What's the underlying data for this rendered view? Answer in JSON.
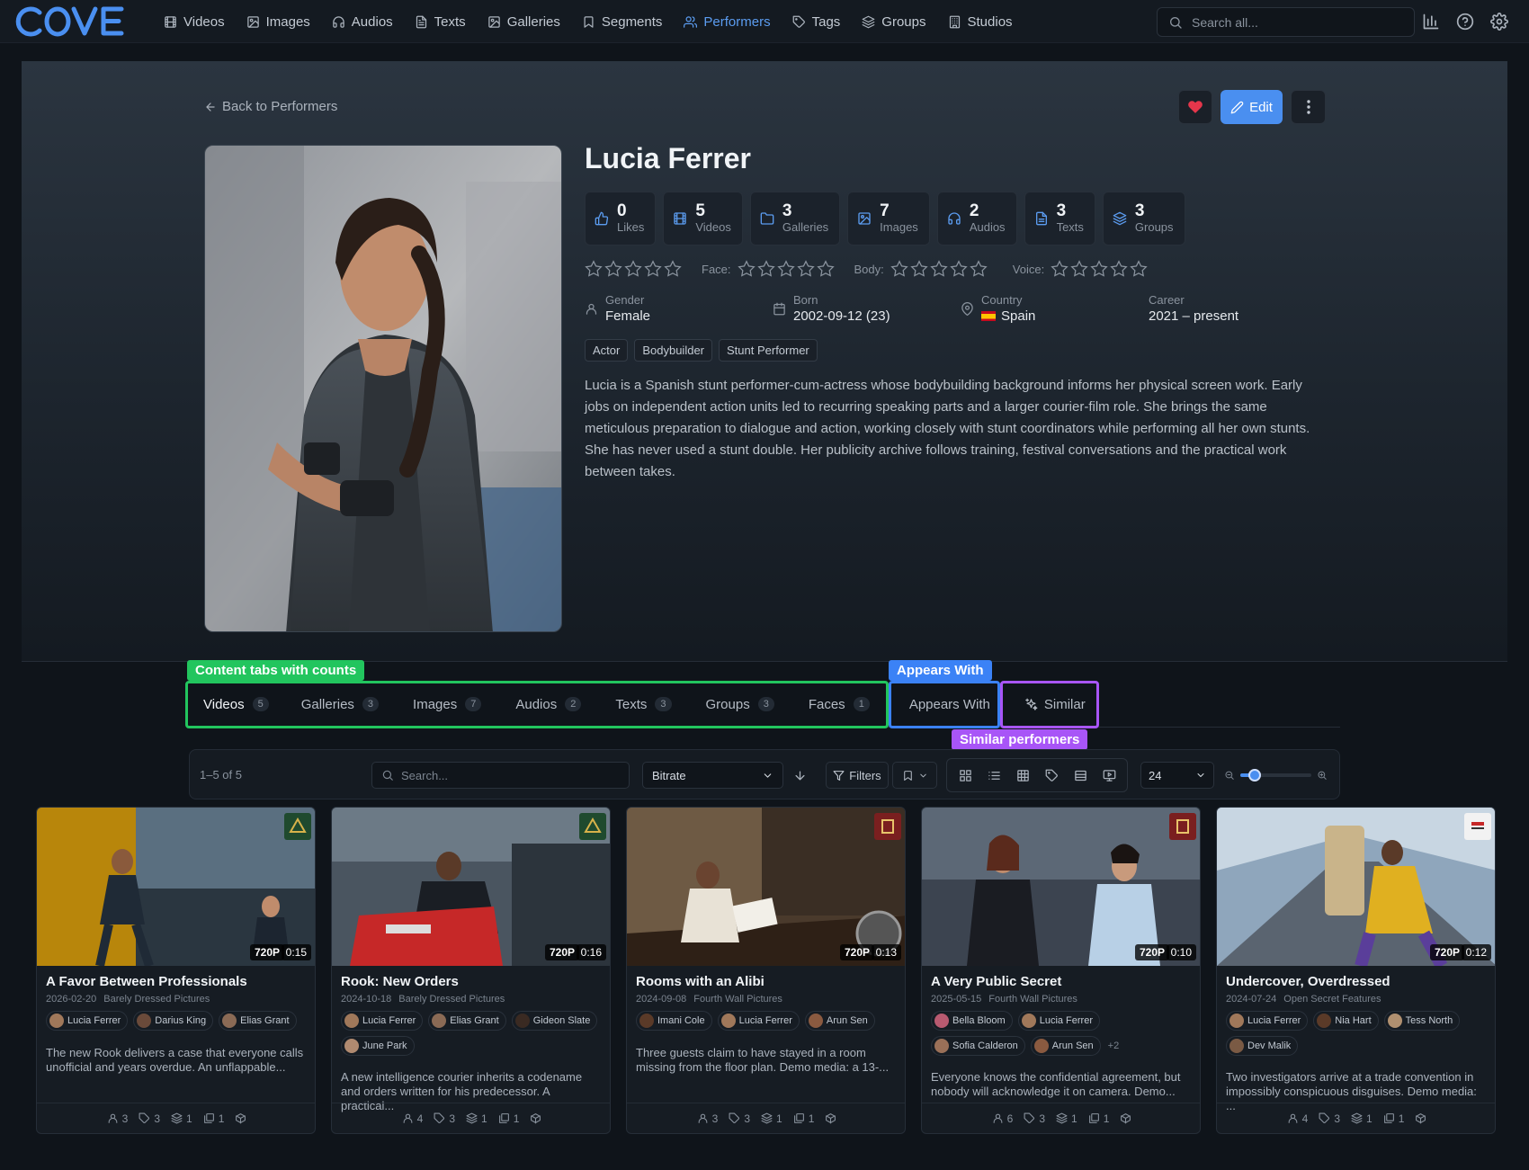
{
  "app": {
    "logo_text": "COVE"
  },
  "nav": {
    "items": [
      {
        "label": "Videos",
        "icon": "film-icon"
      },
      {
        "label": "Images",
        "icon": "image-icon"
      },
      {
        "label": "Audios",
        "icon": "headphones-icon"
      },
      {
        "label": "Texts",
        "icon": "file-text-icon"
      },
      {
        "label": "Galleries",
        "icon": "gallery-icon"
      },
      {
        "label": "Segments",
        "icon": "bookmark-icon"
      },
      {
        "label": "Performers",
        "icon": "users-icon",
        "active": true
      },
      {
        "label": "Tags",
        "icon": "tag-icon"
      },
      {
        "label": "Groups",
        "icon": "layers-icon"
      },
      {
        "label": "Studios",
        "icon": "building-icon"
      }
    ],
    "search_placeholder": "Search all...",
    "right_icons": [
      "stats-icon",
      "help-icon",
      "settings-icon"
    ]
  },
  "performer": {
    "back_label": "Back to Performers",
    "edit_label": "Edit",
    "name": "Lucia Ferrer",
    "stats": [
      {
        "value": "0",
        "label": "Likes",
        "icon": "thumbs-up-icon"
      },
      {
        "value": "5",
        "label": "Videos",
        "icon": "film-icon"
      },
      {
        "value": "3",
        "label": "Galleries",
        "icon": "folder-icon"
      },
      {
        "value": "7",
        "label": "Images",
        "icon": "image-icon"
      },
      {
        "value": "2",
        "label": "Audios",
        "icon": "headphones-icon"
      },
      {
        "value": "3",
        "label": "Texts",
        "icon": "file-text-icon"
      },
      {
        "value": "3",
        "label": "Groups",
        "icon": "layers-icon"
      }
    ],
    "ratings": {
      "overall": 0,
      "face_label": "Face:",
      "face": 0,
      "body_label": "Body:",
      "body": 0,
      "voice_label": "Voice:",
      "voice": 0,
      "max": 5
    },
    "facts": {
      "gender_label": "Gender",
      "gender": "Female",
      "born_label": "Born",
      "born": "2002-09-12 (23)",
      "country_label": "Country",
      "country_flag": "🇪🇸",
      "country": "Spain",
      "career_label": "Career",
      "career": "2021 – present"
    },
    "roles": [
      "Actor",
      "Bodybuilder",
      "Stunt Performer"
    ],
    "bio": "Lucia is a Spanish stunt performer-cum-actress whose bodybuilding background informs her physical screen work. Early jobs on independent action units led to recurring speaking parts and a larger courier-film role. She brings the same meticulous preparation to dialogue and action, working closely with stunt coordinators while performing all her own stunts. She has never used a stunt double. Her publicity archive follows training, festival conversations and the practical work between takes."
  },
  "tabs": [
    {
      "label": "Videos",
      "count": "5",
      "active": true
    },
    {
      "label": "Galleries",
      "count": "3"
    },
    {
      "label": "Images",
      "count": "7"
    },
    {
      "label": "Audios",
      "count": "2"
    },
    {
      "label": "Texts",
      "count": "3"
    },
    {
      "label": "Groups",
      "count": "3"
    },
    {
      "label": "Faces",
      "count": "1"
    },
    {
      "label": "Appears With"
    },
    {
      "label": "Similar",
      "icon": "sparkles-icon"
    }
  ],
  "annotations": {
    "content_tabs": "Content tabs with counts",
    "appears_with": "Appears With",
    "similar": "Similar performers",
    "colors": {
      "green": "#22c55e",
      "blue": "#3b82f6",
      "purple": "#a855f7"
    }
  },
  "toolbar": {
    "result_count": "1–5 of 5",
    "search_placeholder": "Search...",
    "sort_value": "Bitrate",
    "filters_label": "Filters",
    "per_page": "24",
    "zoom_level": 0.2,
    "view_icons": [
      "grid-icon",
      "list-icon",
      "table-icon",
      "tag-view-icon",
      "rows-icon",
      "slideshow-icon"
    ]
  },
  "videos": [
    {
      "title": "A Favor Between Professionals",
      "date": "2026-02-20",
      "studio": "Barely Dressed Pictures",
      "quality": "720P",
      "duration": "0:15",
      "performers": [
        "Lucia Ferrer",
        "Darius King",
        "Elias Grant"
      ],
      "more": "",
      "description": "The new Rook delivers a case that everyone calls unofficial and years overdue. An unflappable...",
      "counts": {
        "performers": "3",
        "tags": "3",
        "groups": "1",
        "galleries": "1"
      }
    },
    {
      "title": "Rook: New Orders",
      "date": "2024-10-18",
      "studio": "Barely Dressed Pictures",
      "quality": "720P",
      "duration": "0:16",
      "performers": [
        "Lucia Ferrer",
        "Elias Grant",
        "Gideon Slate",
        "June Park"
      ],
      "more": "",
      "description": "A new intelligence courier inherits a codename and orders written for his predecessor. A practical...",
      "counts": {
        "performers": "4",
        "tags": "3",
        "groups": "1",
        "galleries": "1"
      }
    },
    {
      "title": "Rooms with an Alibi",
      "date": "2024-09-08",
      "studio": "Fourth Wall Pictures",
      "quality": "720P",
      "duration": "0:13",
      "performers": [
        "Imani Cole",
        "Lucia Ferrer",
        "Arun Sen"
      ],
      "more": "",
      "description": "Three guests claim to have stayed in a room missing from the floor plan. Demo media: a 13-...",
      "counts": {
        "performers": "3",
        "tags": "3",
        "groups": "1",
        "galleries": "1"
      }
    },
    {
      "title": "A Very Public Secret",
      "date": "2025-05-15",
      "studio": "Fourth Wall Pictures",
      "quality": "720P",
      "duration": "0:10",
      "performers": [
        "Bella Bloom",
        "Lucia Ferrer",
        "Sofia Calderon",
        "Arun Sen"
      ],
      "more": "+2",
      "description": "Everyone knows the confidential agreement, but nobody will acknowledge it on camera. Demo...",
      "counts": {
        "performers": "6",
        "tags": "3",
        "groups": "1",
        "galleries": "1"
      }
    },
    {
      "title": "Undercover, Overdressed",
      "date": "2024-07-24",
      "studio": "Open Secret Features",
      "quality": "720P",
      "duration": "0:12",
      "performers": [
        "Lucia Ferrer",
        "Nia Hart",
        "Tess North",
        "Dev Malik"
      ],
      "more": "",
      "description": "Two investigators arrive at a trade convention in impossibly conspicuous disguises. Demo media: ...",
      "counts": {
        "performers": "4",
        "tags": "3",
        "groups": "1",
        "galleries": "1"
      }
    }
  ]
}
